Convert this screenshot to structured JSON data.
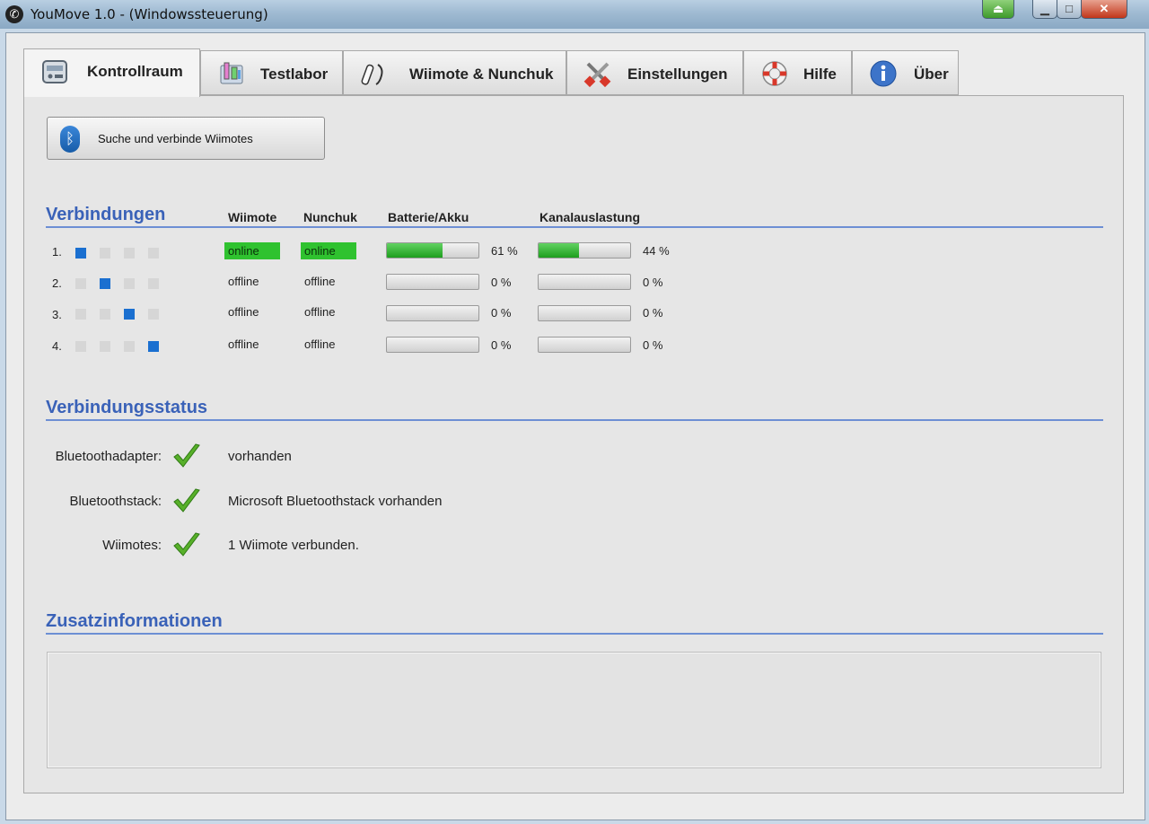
{
  "window": {
    "title": "YouMove 1.0 - (Windowssteuerung)",
    "controls": {
      "minimize": "▁",
      "maximize": "□",
      "close": "✕"
    }
  },
  "tabs": [
    {
      "label": "Kontrollraum",
      "icon": "control-room-icon",
      "active": true
    },
    {
      "label": "Testlabor",
      "icon": "lab-flask-icon",
      "active": false
    },
    {
      "label": "Wiimote & Nunchuk",
      "icon": "wiimote-icon",
      "active": false
    },
    {
      "label": "Einstellungen",
      "icon": "tools-icon",
      "active": false
    },
    {
      "label": "Hilfe",
      "icon": "lifebuoy-icon",
      "active": false
    },
    {
      "label": "Über",
      "icon": "info-icon",
      "active": false
    }
  ],
  "search_button": {
    "label": "Suche und verbinde Wiimotes",
    "icon": "bluetooth-icon"
  },
  "connections": {
    "title": "Verbindungen",
    "columns": {
      "wiimote": "Wiimote",
      "nunchuk": "Nunchuk",
      "battery": "Batterie/Akku",
      "channel": "Kanalauslastung"
    },
    "rows": [
      {
        "num": "1.",
        "led": 1,
        "wiimote": "online",
        "nunchuk": "online",
        "battery": 61,
        "battery_label": "61 %",
        "channel": 44,
        "channel_label": "44 %"
      },
      {
        "num": "2.",
        "led": 2,
        "wiimote": "offline",
        "nunchuk": "offline",
        "battery": 0,
        "battery_label": "0 %",
        "channel": 0,
        "channel_label": "0 %"
      },
      {
        "num": "3.",
        "led": 3,
        "wiimote": "offline",
        "nunchuk": "offline",
        "battery": 0,
        "battery_label": "0 %",
        "channel": 0,
        "channel_label": "0 %"
      },
      {
        "num": "4.",
        "led": 4,
        "wiimote": "offline",
        "nunchuk": "offline",
        "battery": 0,
        "battery_label": "0 %",
        "channel": 0,
        "channel_label": "0 %"
      }
    ]
  },
  "status": {
    "title": "Verbindungsstatus",
    "items": [
      {
        "label": "Bluetoothadapter:",
        "value": "vorhanden"
      },
      {
        "label": "Bluetoothstack:",
        "value": "Microsoft Bluetoothstack vorhanden"
      },
      {
        "label": "Wiimotes:",
        "value": "1 Wiimote verbunden."
      }
    ]
  },
  "extra": {
    "title": "Zusatzinformationen"
  },
  "colors": {
    "accent": "#3a62b8",
    "online": "#2fc22f",
    "led_on": "#1a6fd0",
    "progress": "#1e9e1e"
  }
}
